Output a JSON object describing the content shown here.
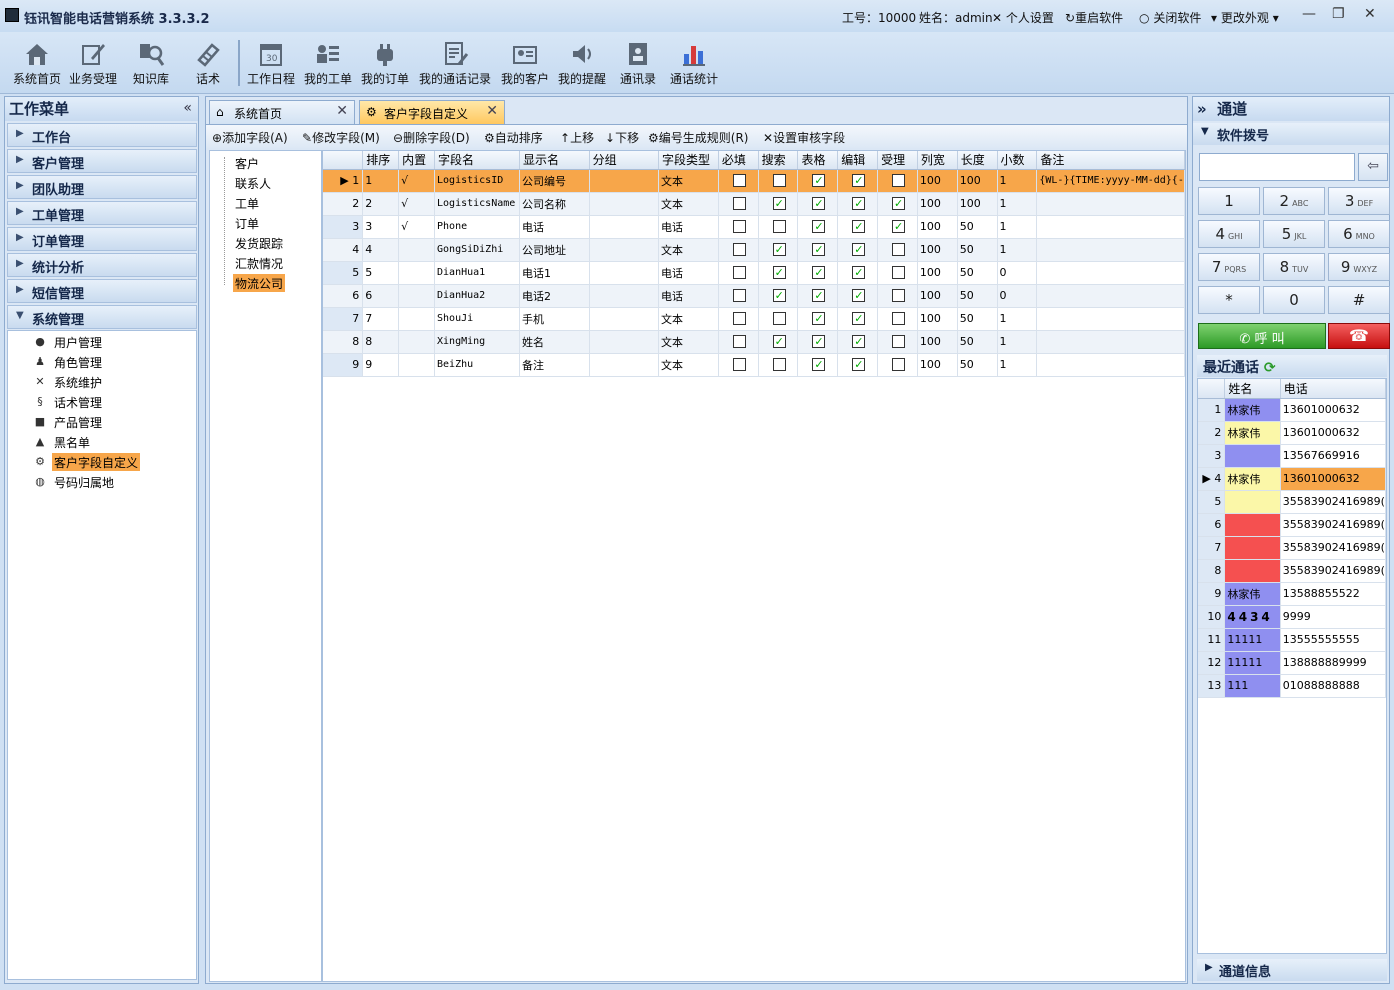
{
  "title": "钰讯智能电话营销系统 3.3.3.2",
  "topbar": {
    "user_id": "工号：10000",
    "user_name": "姓名：admin",
    "personal": "个人设置",
    "restart": "重启软件",
    "close": "关闭软件",
    "skin": "更改外观"
  },
  "toolbar": [
    "系统首页",
    "业务受理",
    "知识库",
    "话术",
    "工作日程",
    "我的工单",
    "我的订单",
    "我的通话记录",
    "我的客户",
    "我的提醒",
    "通讯录",
    "通话统计"
  ],
  "left": {
    "title": "工作菜单",
    "groups": [
      "工作台",
      "客户管理",
      "团队助理",
      "工单管理",
      "订单管理",
      "统计分析",
      "短信管理",
      "系统管理"
    ],
    "sub": [
      "用户管理",
      "角色管理",
      "系统维护",
      "话术管理",
      "产品管理",
      "黑名单",
      "客户字段自定义",
      "号码归属地"
    ]
  },
  "tabs": [
    "系统首页",
    "客户字段自定义"
  ],
  "actions": [
    "添加字段(A)",
    "修改字段(M)",
    "删除字段(D)",
    "自动排序",
    "上移",
    "下移",
    "编号生成规则(R)",
    "设置审核字段"
  ],
  "tree": [
    "客户",
    "联系人",
    "工单",
    "订单",
    "发货跟踪",
    "汇款情况",
    "物流公司"
  ],
  "grid": {
    "headers": [
      "排序",
      "内置",
      "字段名",
      "显示名",
      "分组",
      "字段类型",
      "必填",
      "搜索",
      "表格",
      "编辑",
      "受理",
      "列宽",
      "长度",
      "小数",
      "备注"
    ],
    "rows": [
      {
        "n": "1",
        "sort": "1",
        "builtin": "√",
        "field": "LogisticsID",
        "display": "公司编号",
        "group": "",
        "type": "文本",
        "req": false,
        "search": false,
        "table": true,
        "edit": true,
        "acc": false,
        "width": "100",
        "len": "100",
        "dec": "1",
        "note": "{WL-}{TIME:yyyy-MM-dd}{-"
      },
      {
        "n": "2",
        "sort": "2",
        "builtin": "√",
        "field": "LogisticsName",
        "display": "公司名称",
        "group": "",
        "type": "文本",
        "req": false,
        "search": true,
        "table": true,
        "edit": true,
        "acc": true,
        "width": "100",
        "len": "100",
        "dec": "1",
        "note": ""
      },
      {
        "n": "3",
        "sort": "3",
        "builtin": "√",
        "field": "Phone",
        "display": "电话",
        "group": "",
        "type": "电话",
        "req": false,
        "search": false,
        "table": true,
        "edit": true,
        "acc": true,
        "width": "100",
        "len": "50",
        "dec": "1",
        "note": ""
      },
      {
        "n": "4",
        "sort": "4",
        "builtin": "",
        "field": "GongSiDiZhi",
        "display": "公司地址",
        "group": "",
        "type": "文本",
        "req": false,
        "search": true,
        "table": true,
        "edit": true,
        "acc": false,
        "width": "100",
        "len": "50",
        "dec": "1",
        "note": ""
      },
      {
        "n": "5",
        "sort": "5",
        "builtin": "",
        "field": "DianHua1",
        "display": "电话1",
        "group": "",
        "type": "电话",
        "req": false,
        "search": true,
        "table": true,
        "edit": true,
        "acc": false,
        "width": "100",
        "len": "50",
        "dec": "0",
        "note": ""
      },
      {
        "n": "6",
        "sort": "6",
        "builtin": "",
        "field": "DianHua2",
        "display": "电话2",
        "group": "",
        "type": "电话",
        "req": false,
        "search": true,
        "table": true,
        "edit": true,
        "acc": false,
        "width": "100",
        "len": "50",
        "dec": "0",
        "note": ""
      },
      {
        "n": "7",
        "sort": "7",
        "builtin": "",
        "field": "ShouJi",
        "display": "手机",
        "group": "",
        "type": "文本",
        "req": false,
        "search": false,
        "table": true,
        "edit": true,
        "acc": false,
        "width": "100",
        "len": "50",
        "dec": "1",
        "note": ""
      },
      {
        "n": "8",
        "sort": "8",
        "builtin": "",
        "field": "XingMing",
        "display": "姓名",
        "group": "",
        "type": "文本",
        "req": false,
        "search": true,
        "table": true,
        "edit": true,
        "acc": false,
        "width": "100",
        "len": "50",
        "dec": "1",
        "note": ""
      },
      {
        "n": "9",
        "sort": "9",
        "builtin": "",
        "field": "BeiZhu",
        "display": "备注",
        "group": "",
        "type": "文本",
        "req": false,
        "search": false,
        "table": true,
        "edit": true,
        "acc": false,
        "width": "100",
        "len": "50",
        "dec": "1",
        "note": ""
      }
    ]
  },
  "right": {
    "title": "通道",
    "dial_title": "软件拨号",
    "keys": [
      [
        "1",
        ""
      ],
      [
        "2",
        "ABC"
      ],
      [
        "3",
        "DEF"
      ],
      [
        "4",
        "GHI"
      ],
      [
        "5",
        "JKL"
      ],
      [
        "6",
        "MNO"
      ],
      [
        "7",
        "PQRS"
      ],
      [
        "8",
        "TUV"
      ],
      [
        "9",
        "WXYZ"
      ],
      [
        "*",
        ""
      ],
      [
        "0",
        ""
      ],
      [
        "#",
        ""
      ]
    ],
    "call": "呼 叫",
    "recent_title": "最近通话",
    "recent_headers": [
      "姓名",
      "电话"
    ],
    "recent": [
      {
        "n": "1",
        "name": "林家伟",
        "phone": "13601000632",
        "color": "#8f8ff0"
      },
      {
        "n": "2",
        "name": "林家伟",
        "phone": "13601000632",
        "color": "#fbf7a8"
      },
      {
        "n": "3",
        "name": "",
        "phone": "13567669916",
        "color": "#8f8ff0"
      },
      {
        "n": "4",
        "name": "林家伟",
        "phone": "13601000632",
        "color": "#fbf7a8"
      },
      {
        "n": "5",
        "name": "",
        "phone": "35583902416989(",
        "color": "#fbf7a8"
      },
      {
        "n": "6",
        "name": "",
        "phone": "35583902416989(",
        "color": "#f55050"
      },
      {
        "n": "7",
        "name": "",
        "phone": "35583902416989(",
        "color": "#f55050"
      },
      {
        "n": "8",
        "name": "",
        "phone": "35583902416989(",
        "color": "#f55050"
      },
      {
        "n": "9",
        "name": "林家伟",
        "phone": "13588855522",
        "color": "#8f8ff0"
      },
      {
        "n": "10",
        "name": "4434",
        "phone": "9999",
        "color": "#8f8ff0"
      },
      {
        "n": "11",
        "name": "11111",
        "phone": "13555555555",
        "color": "#8f8ff0"
      },
      {
        "n": "12",
        "name": "11111",
        "phone": "138888889999",
        "color": "#8f8ff0"
      },
      {
        "n": "13",
        "name": "111",
        "phone": "01088888888",
        "color": "#8f8ff0"
      }
    ],
    "channel_info": "通道信息"
  }
}
